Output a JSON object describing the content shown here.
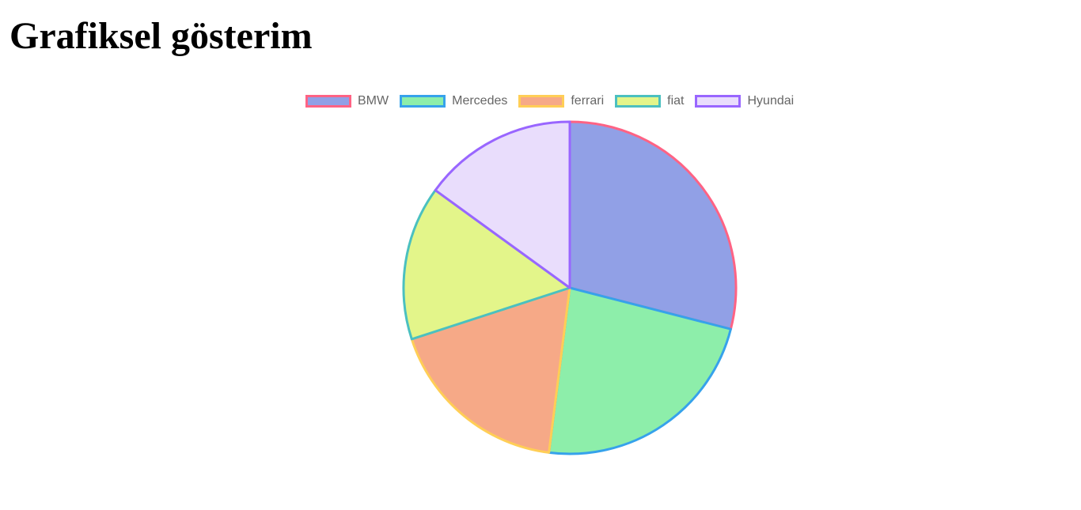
{
  "page": {
    "title": "Grafiksel gösterim"
  },
  "chart_data": {
    "type": "pie",
    "categories": [
      "BMW",
      "Mercedes",
      "ferrari",
      "fiat",
      "Hyundai"
    ],
    "values": [
      29,
      23,
      18,
      15,
      15
    ],
    "fill_colors": [
      "#91a0e6",
      "#8deeaa",
      "#f6a987",
      "#e3f58a",
      "#e9ddfc"
    ],
    "border_colors": [
      "#ff6384",
      "#36a2eb",
      "#ffce56",
      "#4bc0c0",
      "#9966ff"
    ],
    "legend_position": "top"
  }
}
